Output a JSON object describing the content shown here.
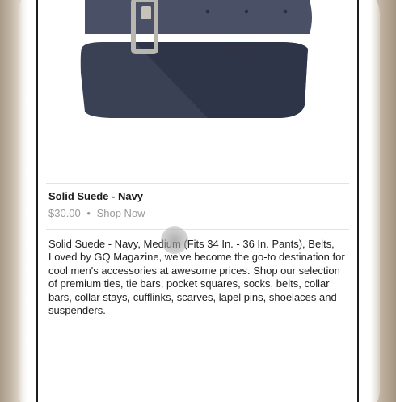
{
  "product": {
    "title": "Solid Suede - Navy",
    "price": "$30.00",
    "separator": "•",
    "shop_label": "Shop Now",
    "description": "Solid Suede - Navy, Medium (Fits 34 In. - 36 In. Pants), Belts, Loved by GQ Magazine, we've become the go-to destination for cool men's accessories at awesome prices. Shop our selection of premium ties, tie bars, pocket squares, socks, belts, collar bars, collar stays, cufflinks, scarves, lapel pins, shoelaces and suspenders.",
    "image_icon": "navy-suede-belt-image"
  },
  "colors": {
    "belt_navy": "#3e4559",
    "buckle_silver": "#b9b6ad",
    "price_gray": "#9a9a9a"
  }
}
